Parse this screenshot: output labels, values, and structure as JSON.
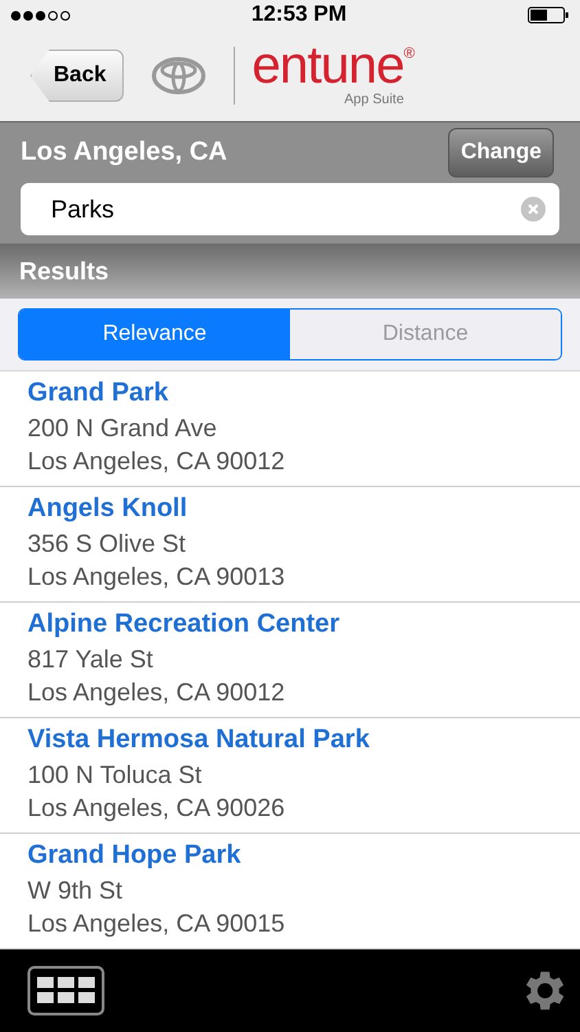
{
  "status_bar": {
    "time": "12:53 PM"
  },
  "header": {
    "back": "Back",
    "brand": "entune",
    "brand_mark": "®",
    "brand_sub": "App Suite"
  },
  "location": {
    "city": "Los Angeles, CA",
    "change": "Change"
  },
  "search": {
    "value": "Parks"
  },
  "results_title": "Results",
  "sort_tabs": [
    {
      "label": "Relevance",
      "selected": true
    },
    {
      "label": "Distance",
      "selected": false
    }
  ],
  "results": [
    {
      "name": "Grand Park",
      "street": "200 N Grand Ave",
      "city": "Los Angeles, CA 90012"
    },
    {
      "name": "Angels Knoll",
      "street": "356 S Olive St",
      "city": "Los Angeles, CA 90013"
    },
    {
      "name": "Alpine Recreation Center",
      "street": "817 Yale St",
      "city": "Los Angeles, CA 90012"
    },
    {
      "name": "Vista Hermosa Natural Park",
      "street": "100 N Toluca St",
      "city": "Los Angeles, CA 90026"
    },
    {
      "name": "Grand Hope Park",
      "street": "W 9th St",
      "city": "Los Angeles, CA 90015"
    }
  ]
}
